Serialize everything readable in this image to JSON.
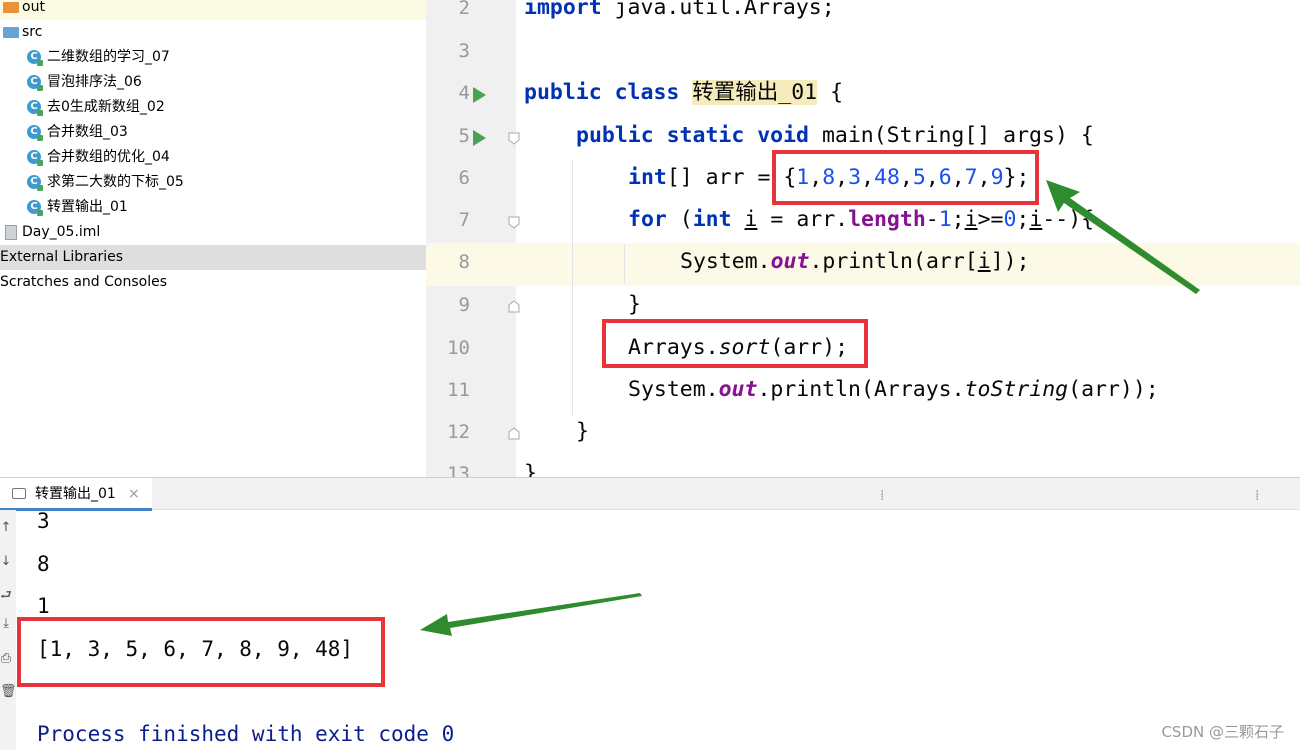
{
  "project_tree": {
    "items": [
      {
        "label": "out",
        "icon": "folder-orange-icon"
      },
      {
        "label": "src",
        "icon": "folder-blue-icon"
      },
      {
        "label": "二维数组的学习_07",
        "icon": "java-class-icon"
      },
      {
        "label": "冒泡排序法_06",
        "icon": "java-class-icon"
      },
      {
        "label": "去0生成新数组_02",
        "icon": "java-class-icon"
      },
      {
        "label": "合并数组_03",
        "icon": "java-class-icon"
      },
      {
        "label": "合并数组的优化_04",
        "icon": "java-class-icon"
      },
      {
        "label": "求第二大数的下标_05",
        "icon": "java-class-icon"
      },
      {
        "label": "转置输出_01",
        "icon": "java-class-icon"
      },
      {
        "label": "Day_05.iml",
        "icon": "iml-file-icon"
      },
      {
        "label": "External Libraries",
        "icon": ""
      },
      {
        "label": "Scratches and Consoles",
        "icon": ""
      }
    ],
    "class_icon_letter": "C"
  },
  "editor": {
    "line_numbers": [
      "2",
      "3",
      "4",
      "5",
      "6",
      "7",
      "8",
      "9",
      "10",
      "11",
      "12",
      "13"
    ],
    "line2": {
      "kw": "import",
      "rest": " java.util.Arrays;"
    },
    "line4": {
      "kw": "public class",
      "classname": "转置输出_01",
      "rest": " {"
    },
    "line5": {
      "kw": "public static void",
      "rest": " main(String[] args) {"
    },
    "line6": {
      "kw": "int",
      "a": "[] arr = {",
      "n1": "1",
      "n2": "8",
      "n3": "3",
      "n4": "48",
      "n5": "5",
      "n6": "6",
      "n7": "7",
      "n8": "9",
      "c": ",",
      "end": "};"
    },
    "line7": {
      "kw_for": "for",
      "p1": " (",
      "kw_int": "int",
      "p2": " ",
      "i": "i",
      "p3": " = arr.",
      "len": "length",
      "p4": "-",
      "one": "1",
      "p5": ";",
      "p6": ">=",
      "zero": "0",
      "p7": ";",
      "p8": "--){"
    },
    "line8": {
      "sys": "System.",
      "out": "out",
      "rest1": ".println(arr[",
      "i": "i",
      "rest2": "]);"
    },
    "line9": "}",
    "line10": {
      "cls": "Arrays.",
      "sort": "sort",
      "rest": "(arr);"
    },
    "line11": {
      "sys": "System.",
      "out": "out",
      "mid": ".println(Arrays.",
      "tostr": "toString",
      "rest": "(arr));"
    },
    "line12": "}",
    "line13": "}"
  },
  "run_panel": {
    "tab_label": "转置输出_01",
    "close": "×",
    "output": [
      "3",
      "8",
      "1",
      "[1, 3, 5, 6, 7, 8, 9, 48]",
      "Process finished with exit code 0"
    ],
    "tools": [
      "↑",
      "↓",
      "⮐",
      "⤓",
      "⎙",
      "🗑"
    ]
  },
  "watermark": "CSDN @三颗石子",
  "colors": {
    "highlight_box": "#e8333a",
    "arrow": "#2e8b2e",
    "keyword": "#0033b3",
    "number": "#1750eb",
    "field": "#871094"
  }
}
